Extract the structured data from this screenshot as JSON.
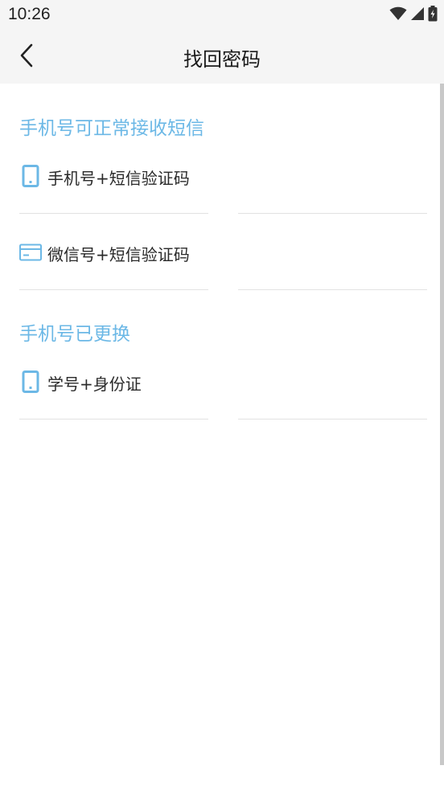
{
  "status_bar": {
    "time": "10:26",
    "icons": [
      "wifi-icon",
      "cell-signal-icon",
      "battery-charging-icon"
    ]
  },
  "app_bar": {
    "back_icon": "chevron-left-icon",
    "title": "找回密码"
  },
  "sections": [
    {
      "header": "手机号可正常接收短信",
      "options": [
        {
          "icon": "phone-icon",
          "label": "手机号+短信验证码"
        },
        {
          "icon": "card-icon",
          "label": "微信号+短信验证码"
        }
      ]
    },
    {
      "header": "手机号已更换",
      "options": [
        {
          "icon": "phone-icon",
          "label": "学号+身份证"
        }
      ]
    }
  ],
  "colors": {
    "accent": "#6cb8e6",
    "app_bar_bg": "#f5f5f5",
    "text_primary": "#2a2a2a",
    "divider": "#e2e2e2"
  }
}
